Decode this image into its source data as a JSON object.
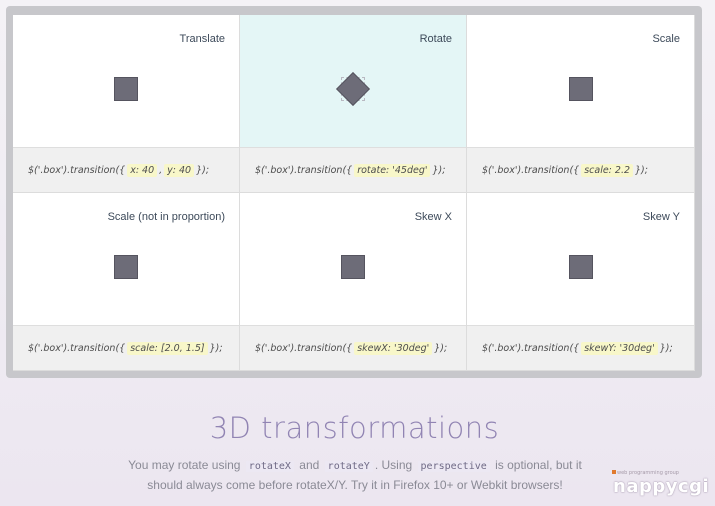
{
  "cards": [
    {
      "title": "Translate",
      "code_prefix": "$('.box').transition({",
      "params": [
        "x: 40",
        "y: 40"
      ],
      "code_suffix": "});",
      "active": false
    },
    {
      "title": "Rotate",
      "code_prefix": "$('.box').transition({",
      "params": [
        "rotate: '45deg'"
      ],
      "code_suffix": "});",
      "active": true
    },
    {
      "title": "Scale",
      "code_prefix": "$('.box').transition({",
      "params": [
        "scale: 2.2"
      ],
      "code_suffix": "});",
      "active": false
    },
    {
      "title": "Scale (not in proportion)",
      "code_prefix": "$('.box').transition({",
      "params": [
        "scale: [2.0, 1.5]"
      ],
      "code_suffix": "});",
      "active": false
    },
    {
      "title": "Skew X",
      "code_prefix": "$('.box').transition({",
      "params": [
        "skewX: '30deg'"
      ],
      "code_suffix": "});",
      "active": false
    },
    {
      "title": "Skew Y",
      "code_prefix": "$('.box').transition({",
      "params": [
        "skewY: '30deg'"
      ],
      "code_suffix": "});",
      "active": false
    }
  ],
  "section": {
    "heading": "3D transformations",
    "text_1": "You may rotate using",
    "code_1": "rotateX",
    "text_2": "and",
    "code_2": "rotateY",
    "text_3": ". Using",
    "code_3": "perspective",
    "text_4": "is optional, but it should always come before rotateX/Y. Try it in Firefox 10+ or Webkit browsers!"
  },
  "watermark": {
    "tagline": "web programming group",
    "brand": "nappycgi"
  },
  "colors": {
    "box": "#6d6c78",
    "active_bg": "#e4f6f6",
    "heading": "#9184b3",
    "highlight": "#f8f7c9"
  }
}
